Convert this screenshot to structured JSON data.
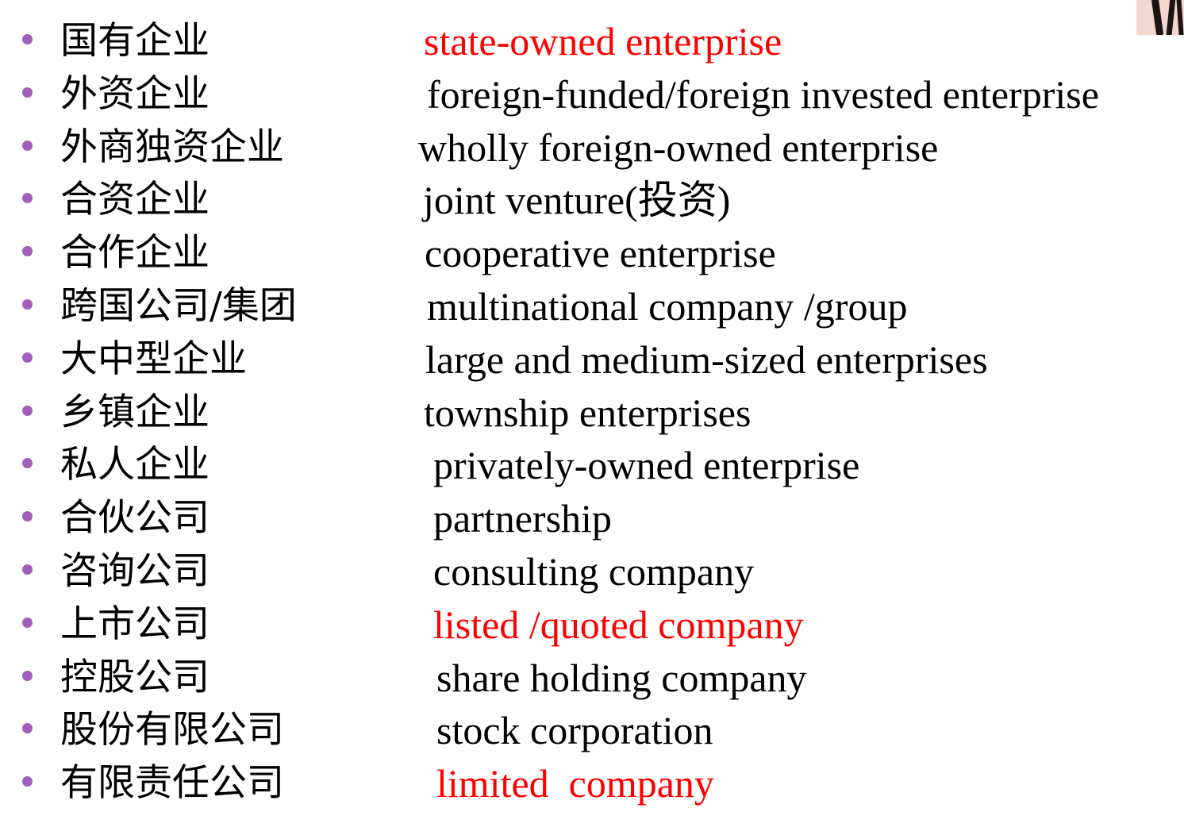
{
  "accent_color": "#ff0000",
  "bullet_color": "#a05fb8",
  "terms": [
    {
      "zh": "国有企业",
      "en": "state-owned enterprise",
      "highlight": true
    },
    {
      "zh": "外资企业",
      "en": "foreign-funded/foreign invested enterprise",
      "highlight": false
    },
    {
      "zh": "外商独资企业",
      "en": "wholly foreign-owned enterprise",
      "highlight": false
    },
    {
      "zh": "合资企业",
      "en": "joint venture(投资)",
      "highlight": false
    },
    {
      "zh": "合作企业",
      "en": "cooperative enterprise",
      "highlight": false
    },
    {
      "zh": "跨国公司/集团",
      "en": "multinational company /group",
      "highlight": false
    },
    {
      "zh": "大中型企业",
      "en": "large and medium-sized enterprises",
      "highlight": false
    },
    {
      "zh": "乡镇企业",
      "en": "township enterprises",
      "highlight": false
    },
    {
      "zh": "私人企业",
      "en": "privately-owned enterprise",
      "highlight": false
    },
    {
      "zh": "合伙公司",
      "en": "partnership",
      "highlight": false
    },
    {
      "zh": "咨询公司",
      "en": "consulting company",
      "highlight": false
    },
    {
      "zh": "上市公司",
      "en": "listed /quoted company",
      "highlight": true
    },
    {
      "zh": "控股公司",
      "en": "share holding company",
      "highlight": false
    },
    {
      "zh": "股份有限公司",
      "en": "stock corporation",
      "highlight": false
    },
    {
      "zh": "有限责任公司",
      "en": "limited  company",
      "highlight": true
    }
  ]
}
